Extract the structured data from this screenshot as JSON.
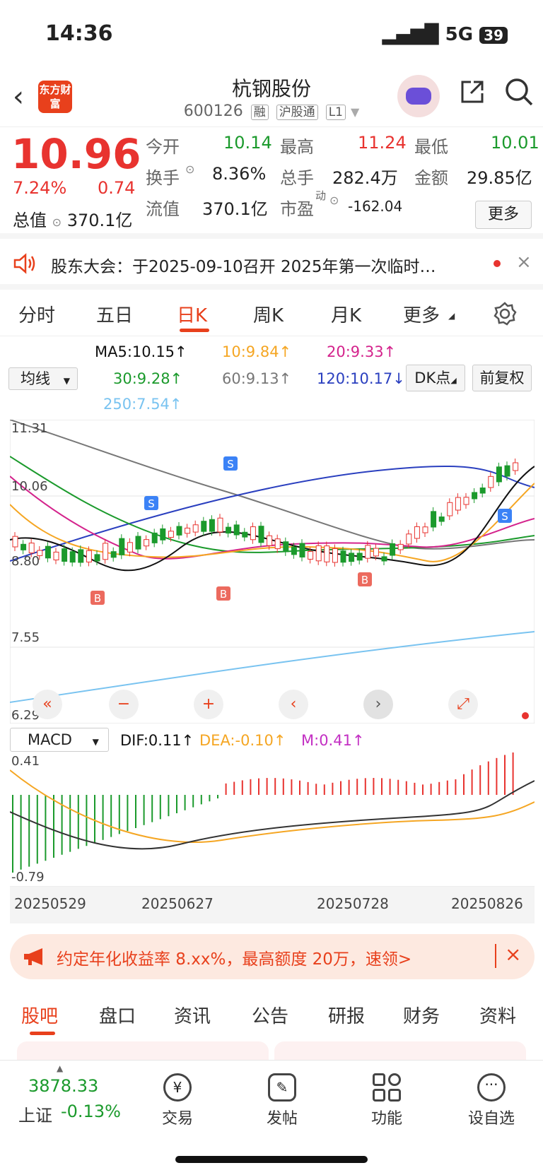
{
  "status": {
    "time": "14:36",
    "network": "5G",
    "battery": "39"
  },
  "header": {
    "logo": "东方财富",
    "stock_name": "杭钢股份",
    "code": "600126",
    "tags": [
      "融",
      "沪股通",
      "L1"
    ]
  },
  "quote": {
    "price": "10.96",
    "change_pct": "7.24%",
    "change": "0.74",
    "open_label": "今开",
    "open": "10.14",
    "high_label": "最高",
    "high": "11.24",
    "low_label": "最低",
    "low": "10.01",
    "turnover_label": "换手",
    "turnover": "8.36%",
    "volume_label": "总手",
    "volume": "282.4万",
    "amount_label": "金额",
    "amount": "29.85亿",
    "mcap_label": "总值",
    "mcap": "370.1亿",
    "float_label": "流值",
    "float": "370.1亿",
    "pe_label": "市盈",
    "pe_sup": "动",
    "pe": "-162.04",
    "more": "更多"
  },
  "notice": {
    "text": "股东大会：于2025-09-10召开 2025年第一次临时…"
  },
  "periods": [
    "分时",
    "五日",
    "日K",
    "周K",
    "月K",
    "更多"
  ],
  "ma": {
    "selector": "均线",
    "ma5": "MA5:10.15↑",
    "ma10": "10:9.84↑",
    "ma20": "20:9.33↑",
    "ma30": "30:9.28↑",
    "ma60": "60:9.13↑",
    "ma120": "120:10.17↓",
    "ma250": "250:7.54↑",
    "dk": "DK点",
    "adjust": "前复权",
    "colors": {
      "ma5": "#111111",
      "ma10": "#f5a623",
      "ma20": "#d4238c",
      "ma30": "#1b9a2c",
      "ma60": "#777777",
      "ma120": "#2a3fbf",
      "ma250": "#79c3f0"
    }
  },
  "kline": {
    "y_labels": [
      "11.31",
      "10.06",
      "8.80",
      "7.55",
      "6.29"
    ],
    "markers": [
      "S",
      "S",
      "B",
      "B",
      "B",
      "S"
    ]
  },
  "macd": {
    "selector": "MACD",
    "dif": "DIF:0.11↑",
    "dea": "DEA:-0.10↑",
    "m": "M:0.41↑",
    "y_top": "0.41",
    "y_bottom": "-0.79",
    "dates": [
      "20250529",
      "20250627",
      "20250728",
      "20250826"
    ]
  },
  "promo": {
    "text": "约定年化收益率 8.xx%，最高额度 20万，速领>"
  },
  "bottom_tabs": [
    "股吧",
    "盘口",
    "资讯",
    "公告",
    "研报",
    "财务",
    "资料"
  ],
  "navbar": {
    "index_value": "3878.33",
    "index_name": "上证",
    "index_change": "-0.13%",
    "items": [
      "交易",
      "发帖",
      "功能",
      "设自选"
    ]
  }
}
